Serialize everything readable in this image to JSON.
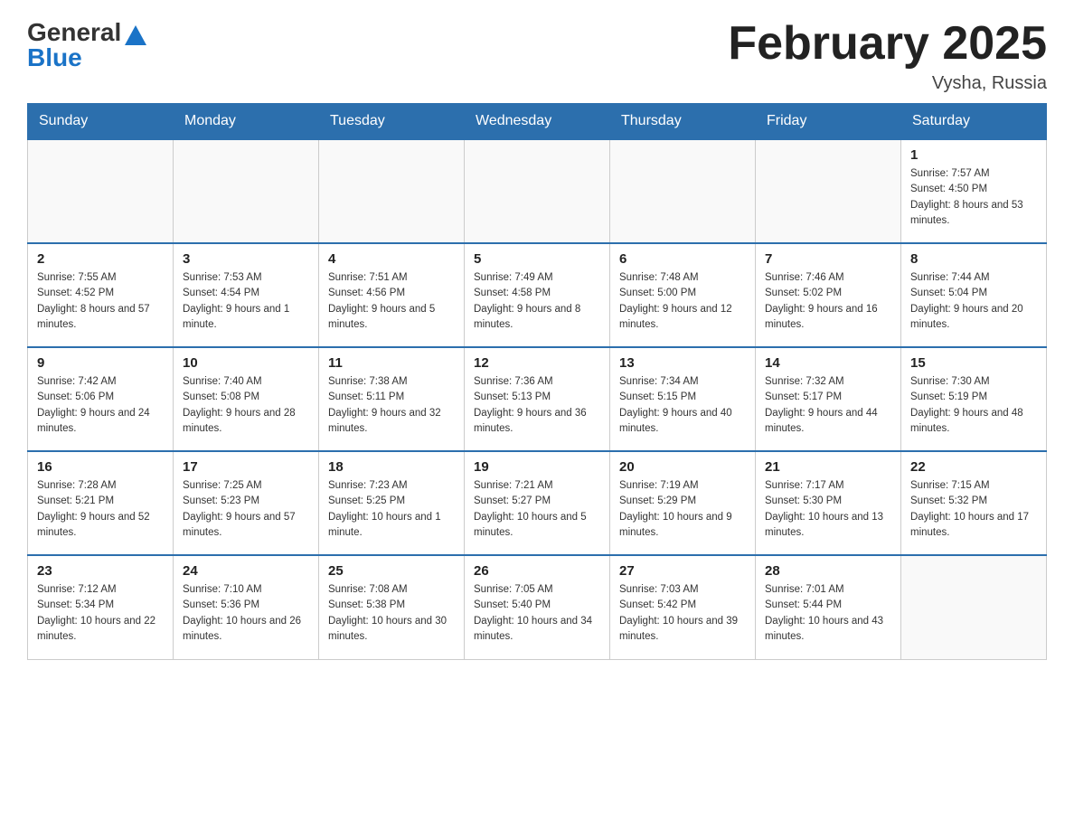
{
  "logo": {
    "general": "General",
    "blue": "Blue"
  },
  "header": {
    "title": "February 2025",
    "location": "Vysha, Russia"
  },
  "days_of_week": [
    "Sunday",
    "Monday",
    "Tuesday",
    "Wednesday",
    "Thursday",
    "Friday",
    "Saturday"
  ],
  "weeks": [
    [
      {
        "day": "",
        "info": ""
      },
      {
        "day": "",
        "info": ""
      },
      {
        "day": "",
        "info": ""
      },
      {
        "day": "",
        "info": ""
      },
      {
        "day": "",
        "info": ""
      },
      {
        "day": "",
        "info": ""
      },
      {
        "day": "1",
        "info": "Sunrise: 7:57 AM\nSunset: 4:50 PM\nDaylight: 8 hours and 53 minutes."
      }
    ],
    [
      {
        "day": "2",
        "info": "Sunrise: 7:55 AM\nSunset: 4:52 PM\nDaylight: 8 hours and 57 minutes."
      },
      {
        "day": "3",
        "info": "Sunrise: 7:53 AM\nSunset: 4:54 PM\nDaylight: 9 hours and 1 minute."
      },
      {
        "day": "4",
        "info": "Sunrise: 7:51 AM\nSunset: 4:56 PM\nDaylight: 9 hours and 5 minutes."
      },
      {
        "day": "5",
        "info": "Sunrise: 7:49 AM\nSunset: 4:58 PM\nDaylight: 9 hours and 8 minutes."
      },
      {
        "day": "6",
        "info": "Sunrise: 7:48 AM\nSunset: 5:00 PM\nDaylight: 9 hours and 12 minutes."
      },
      {
        "day": "7",
        "info": "Sunrise: 7:46 AM\nSunset: 5:02 PM\nDaylight: 9 hours and 16 minutes."
      },
      {
        "day": "8",
        "info": "Sunrise: 7:44 AM\nSunset: 5:04 PM\nDaylight: 9 hours and 20 minutes."
      }
    ],
    [
      {
        "day": "9",
        "info": "Sunrise: 7:42 AM\nSunset: 5:06 PM\nDaylight: 9 hours and 24 minutes."
      },
      {
        "day": "10",
        "info": "Sunrise: 7:40 AM\nSunset: 5:08 PM\nDaylight: 9 hours and 28 minutes."
      },
      {
        "day": "11",
        "info": "Sunrise: 7:38 AM\nSunset: 5:11 PM\nDaylight: 9 hours and 32 minutes."
      },
      {
        "day": "12",
        "info": "Sunrise: 7:36 AM\nSunset: 5:13 PM\nDaylight: 9 hours and 36 minutes."
      },
      {
        "day": "13",
        "info": "Sunrise: 7:34 AM\nSunset: 5:15 PM\nDaylight: 9 hours and 40 minutes."
      },
      {
        "day": "14",
        "info": "Sunrise: 7:32 AM\nSunset: 5:17 PM\nDaylight: 9 hours and 44 minutes."
      },
      {
        "day": "15",
        "info": "Sunrise: 7:30 AM\nSunset: 5:19 PM\nDaylight: 9 hours and 48 minutes."
      }
    ],
    [
      {
        "day": "16",
        "info": "Sunrise: 7:28 AM\nSunset: 5:21 PM\nDaylight: 9 hours and 52 minutes."
      },
      {
        "day": "17",
        "info": "Sunrise: 7:25 AM\nSunset: 5:23 PM\nDaylight: 9 hours and 57 minutes."
      },
      {
        "day": "18",
        "info": "Sunrise: 7:23 AM\nSunset: 5:25 PM\nDaylight: 10 hours and 1 minute."
      },
      {
        "day": "19",
        "info": "Sunrise: 7:21 AM\nSunset: 5:27 PM\nDaylight: 10 hours and 5 minutes."
      },
      {
        "day": "20",
        "info": "Sunrise: 7:19 AM\nSunset: 5:29 PM\nDaylight: 10 hours and 9 minutes."
      },
      {
        "day": "21",
        "info": "Sunrise: 7:17 AM\nSunset: 5:30 PM\nDaylight: 10 hours and 13 minutes."
      },
      {
        "day": "22",
        "info": "Sunrise: 7:15 AM\nSunset: 5:32 PM\nDaylight: 10 hours and 17 minutes."
      }
    ],
    [
      {
        "day": "23",
        "info": "Sunrise: 7:12 AM\nSunset: 5:34 PM\nDaylight: 10 hours and 22 minutes."
      },
      {
        "day": "24",
        "info": "Sunrise: 7:10 AM\nSunset: 5:36 PM\nDaylight: 10 hours and 26 minutes."
      },
      {
        "day": "25",
        "info": "Sunrise: 7:08 AM\nSunset: 5:38 PM\nDaylight: 10 hours and 30 minutes."
      },
      {
        "day": "26",
        "info": "Sunrise: 7:05 AM\nSunset: 5:40 PM\nDaylight: 10 hours and 34 minutes."
      },
      {
        "day": "27",
        "info": "Sunrise: 7:03 AM\nSunset: 5:42 PM\nDaylight: 10 hours and 39 minutes."
      },
      {
        "day": "28",
        "info": "Sunrise: 7:01 AM\nSunset: 5:44 PM\nDaylight: 10 hours and 43 minutes."
      },
      {
        "day": "",
        "info": ""
      }
    ]
  ]
}
